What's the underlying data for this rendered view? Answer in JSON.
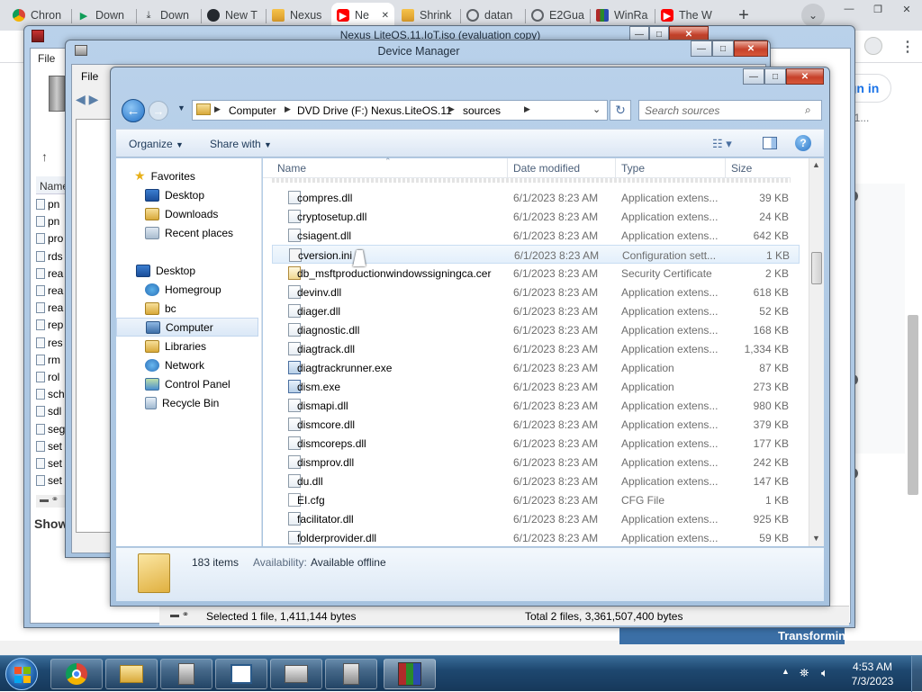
{
  "browser": {
    "tabs": [
      {
        "title": "Chron",
        "icon": "chrome-icon"
      },
      {
        "title": "Down",
        "icon": "play-icon"
      },
      {
        "title": "Down",
        "icon": "download-icon"
      },
      {
        "title": "New T",
        "icon": "github-icon"
      },
      {
        "title": "Nexus",
        "icon": "tool-icon"
      },
      {
        "title": "Ne",
        "icon": "youtube-icon",
        "active": true
      },
      {
        "title": "Shrink",
        "icon": "tool-icon"
      },
      {
        "title": "datan",
        "icon": "globe-icon"
      },
      {
        "title": "E2Gua",
        "icon": "globe-icon"
      },
      {
        "title": "WinRa",
        "icon": "winrar-icon"
      },
      {
        "title": "The W",
        "icon": "youtube-icon"
      }
    ],
    "new_tab": "+",
    "sign_in": "Sign in",
    "side_snippets": [
      "s · 1..."
    ]
  },
  "bg_window": {
    "title": "Nexus LiteOS.11.IoT.iso (evaluation copy)",
    "menu_file": "File",
    "col_name": "Name",
    "files": [
      "pn",
      "pn",
      "pro",
      "rds",
      "rea",
      "rea",
      "rea",
      "rep",
      "res",
      "rm",
      "rol",
      "sch",
      "sdl",
      "seg",
      "set",
      "set",
      "set"
    ],
    "status_left": "Selected 1 file, 1,411,144 bytes",
    "status_right": "Total 2 files, 3,361,507,400 bytes",
    "show_label": "Show",
    "transforming": "Transforming"
  },
  "device_manager": {
    "title": "Device Manager",
    "menu_file": "File"
  },
  "explorer": {
    "breadcrumb": [
      "Computer",
      "DVD Drive (F:) Nexus.LiteOS.11",
      "sources"
    ],
    "search_placeholder": "Search sources",
    "toolbar": {
      "organize": "Organize",
      "share": "Share with"
    },
    "nav": {
      "favorites": "Favorites",
      "fav_items": [
        "Desktop",
        "Downloads",
        "Recent places"
      ],
      "desktop": "Desktop",
      "tree": [
        "Homegroup",
        "bc",
        "Computer",
        "Libraries",
        "Network",
        "Control Panel",
        "Recycle Bin"
      ]
    },
    "columns": {
      "name": "Name",
      "date": "Date modified",
      "type": "Type",
      "size": "Size"
    },
    "files": [
      {
        "name": "compres.dll",
        "date": "6/1/2023 8:23 AM",
        "type": "Application extens...",
        "size": "39 KB",
        "kind": "dll"
      },
      {
        "name": "cryptosetup.dll",
        "date": "6/1/2023 8:23 AM",
        "type": "Application extens...",
        "size": "24 KB",
        "kind": "dll"
      },
      {
        "name": "csiagent.dll",
        "date": "6/1/2023 8:23 AM",
        "type": "Application extens...",
        "size": "642 KB",
        "kind": "dll"
      },
      {
        "name": "cversion.ini",
        "date": "6/1/2023 8:23 AM",
        "type": "Configuration sett...",
        "size": "1 KB",
        "kind": "ini"
      },
      {
        "name": "db_msftproductionwindowssigningca.cer",
        "date": "6/1/2023 8:23 AM",
        "type": "Security Certificate",
        "size": "2 KB",
        "kind": "cer"
      },
      {
        "name": "devinv.dll",
        "date": "6/1/2023 8:23 AM",
        "type": "Application extens...",
        "size": "618 KB",
        "kind": "dll"
      },
      {
        "name": "diager.dll",
        "date": "6/1/2023 8:23 AM",
        "type": "Application extens...",
        "size": "52 KB",
        "kind": "dll"
      },
      {
        "name": "diagnostic.dll",
        "date": "6/1/2023 8:23 AM",
        "type": "Application extens...",
        "size": "168 KB",
        "kind": "dll"
      },
      {
        "name": "diagtrack.dll",
        "date": "6/1/2023 8:23 AM",
        "type": "Application extens...",
        "size": "1,334 KB",
        "kind": "dll"
      },
      {
        "name": "diagtrackrunner.exe",
        "date": "6/1/2023 8:23 AM",
        "type": "Application",
        "size": "87 KB",
        "kind": "exe"
      },
      {
        "name": "dism.exe",
        "date": "6/1/2023 8:23 AM",
        "type": "Application",
        "size": "273 KB",
        "kind": "exe"
      },
      {
        "name": "dismapi.dll",
        "date": "6/1/2023 8:23 AM",
        "type": "Application extens...",
        "size": "980 KB",
        "kind": "dll"
      },
      {
        "name": "dismcore.dll",
        "date": "6/1/2023 8:23 AM",
        "type": "Application extens...",
        "size": "379 KB",
        "kind": "dll"
      },
      {
        "name": "dismcoreps.dll",
        "date": "6/1/2023 8:23 AM",
        "type": "Application extens...",
        "size": "177 KB",
        "kind": "dll"
      },
      {
        "name": "dismprov.dll",
        "date": "6/1/2023 8:23 AM",
        "type": "Application extens...",
        "size": "242 KB",
        "kind": "dll"
      },
      {
        "name": "du.dll",
        "date": "6/1/2023 8:23 AM",
        "type": "Application extens...",
        "size": "147 KB",
        "kind": "dll"
      },
      {
        "name": "EI.cfg",
        "date": "6/1/2023 8:23 AM",
        "type": "CFG File",
        "size": "1 KB",
        "kind": "cfg"
      },
      {
        "name": "facilitator.dll",
        "date": "6/1/2023 8:23 AM",
        "type": "Application extens...",
        "size": "925 KB",
        "kind": "dll"
      },
      {
        "name": "folderprovider.dll",
        "date": "6/1/2023 8:23 AM",
        "type": "Application extens...",
        "size": "59 KB",
        "kind": "dll"
      }
    ],
    "details": {
      "count": "183 items",
      "availability_label": "Availability:",
      "availability_value": "Available offline"
    }
  },
  "taskbar": {
    "time": "4:53 AM",
    "date": "7/3/2023"
  }
}
